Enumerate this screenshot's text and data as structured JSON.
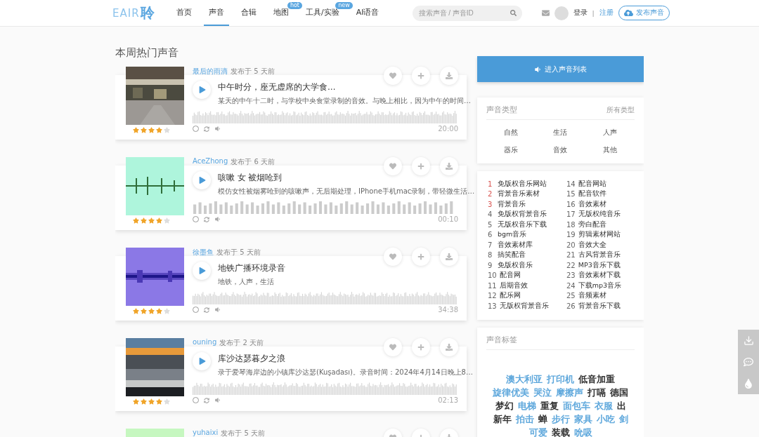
{
  "header": {
    "logo": {
      "latin": "EAIR",
      "hanzi": "聆"
    },
    "nav": [
      {
        "label": "首页",
        "selected": false
      },
      {
        "label": "声音",
        "selected": true
      },
      {
        "label": "合辑",
        "selected": false
      },
      {
        "label": "地图",
        "selected": false,
        "badge": "hot"
      },
      {
        "label": "工具/实验",
        "selected": false,
        "badge": "new"
      },
      {
        "label": "AI语音",
        "selected": false
      }
    ],
    "search": {
      "placeholder": "搜索声音 / 声音ID"
    },
    "login": "登录",
    "separator": "|",
    "register": "注册",
    "publish": "发布声音"
  },
  "hot": {
    "title": "本周热门声音",
    "items": [
      {
        "author": "最后的雨滴",
        "posted": "发布于 5 天前",
        "stars": 4,
        "title": "中午时分，座无虚席的大学食…",
        "description": "某天的中午十二时，与学校中央食堂录制的音效。与晚上相比，因为中午的时间…",
        "duration": "20:00"
      },
      {
        "author": "AceZhong",
        "posted": "发布于 6 天前",
        "stars": 4,
        "title": "咳嗽 女 被烟呛到",
        "description": "模仿女性被烟雾呛到的咳嗽声，无后期处理，IPhone手机mac录制，带轻微生活…",
        "duration": "00:10"
      },
      {
        "author": "徐墨鱼",
        "posted": "发布于 5 天前",
        "stars": 4,
        "title": "地铁广播环境录音",
        "description": "地铁，人声，生活",
        "duration": "34:38"
      },
      {
        "author": "ouning",
        "posted": "发布于 2 天前",
        "stars": 4,
        "title": "库沙达瑟暮夕之浪",
        "description": "录于爱琴海岸边的小镇库沙达瑟(Kuşadası)。录音时间：2024年4月14日晚上8…",
        "duration": "02:13"
      },
      {
        "author": "yuhaixi",
        "posted": "发布于 5 天前"
      }
    ]
  },
  "sidebar": {
    "list_button": "进入声音列表",
    "types": {
      "title": "声音类型",
      "all": "所有类型",
      "items": [
        "自然",
        "生活",
        "人声",
        "器乐",
        "音效",
        "其他"
      ]
    },
    "ranking": [
      {
        "rank": "1",
        "label": "免版权音乐网站",
        "highlighted": true
      },
      {
        "rank": "2",
        "label": "背景音乐素材",
        "highlighted": true
      },
      {
        "rank": "3",
        "label": "背景音乐",
        "highlighted": true
      },
      {
        "rank": "4",
        "label": "免版权背景音乐",
        "highlighted": false
      },
      {
        "rank": "5",
        "label": "无版权音乐下载",
        "highlighted": false
      },
      {
        "rank": "6",
        "label": "bgm音乐",
        "highlighted": false
      },
      {
        "rank": "7",
        "label": "音效素材库",
        "highlighted": false
      },
      {
        "rank": "8",
        "label": "搞笑配音",
        "highlighted": false
      },
      {
        "rank": "9",
        "label": "免版权音乐",
        "highlighted": false
      },
      {
        "rank": "10",
        "label": "配音网",
        "highlighted": false
      },
      {
        "rank": "11",
        "label": "后期音效",
        "highlighted": false
      },
      {
        "rank": "12",
        "label": "配乐网",
        "highlighted": false
      },
      {
        "rank": "13",
        "label": "无版权背景音乐",
        "highlighted": false
      },
      {
        "rank": "14",
        "label": "配音网站",
        "highlighted": false
      },
      {
        "rank": "15",
        "label": "配音软件",
        "highlighted": false
      },
      {
        "rank": "16",
        "label": "音效素材",
        "highlighted": false
      },
      {
        "rank": "17",
        "label": "无版权纯音乐",
        "highlighted": false
      },
      {
        "rank": "18",
        "label": "旁白配音",
        "highlighted": false
      },
      {
        "rank": "19",
        "label": "剪辑素材网站",
        "highlighted": false
      },
      {
        "rank": "20",
        "label": "音效大全",
        "highlighted": false
      },
      {
        "rank": "21",
        "label": "古风背景音乐",
        "highlighted": false
      },
      {
        "rank": "22",
        "label": "MP3音乐下载",
        "highlighted": false
      },
      {
        "rank": "23",
        "label": "音效素材下载",
        "highlighted": false
      },
      {
        "rank": "24",
        "label": "下载mp3音乐",
        "highlighted": false
      },
      {
        "rank": "25",
        "label": "音频素材",
        "highlighted": false
      },
      {
        "rank": "26",
        "label": "背景音乐下载",
        "highlighted": false
      }
    ],
    "tags": {
      "title": "声音标签",
      "items": [
        {
          "label": "澳大利亚",
          "color": "#5fa8dc"
        },
        {
          "label": "打印机",
          "color": "#5fa8dc"
        },
        {
          "label": "低音加重",
          "color": "#333333"
        },
        {
          "label": "旋律优美",
          "color": "#5fa8dc"
        },
        {
          "label": "哭泣",
          "color": "#5fa8dc"
        },
        {
          "label": "摩擦声",
          "color": "#5fa8dc"
        },
        {
          "label": "打嗝",
          "color": "#333333"
        },
        {
          "label": "德国",
          "color": "#333333"
        },
        {
          "label": "梦幻",
          "color": "#333333"
        },
        {
          "label": "电梯",
          "color": "#5fa8dc"
        },
        {
          "label": "重复",
          "color": "#333333"
        },
        {
          "label": "面包车",
          "color": "#5fa8dc"
        },
        {
          "label": "衣服",
          "color": "#5fa8dc"
        },
        {
          "label": "出",
          "color": "#333333"
        },
        {
          "label": "新年",
          "color": "#333333"
        },
        {
          "label": "拍击",
          "color": "#5fa8dc"
        },
        {
          "label": "蝉",
          "color": "#333333"
        },
        {
          "label": "步行",
          "color": "#5fa8dc"
        },
        {
          "label": "家具",
          "color": "#5fa8dc"
        },
        {
          "label": "小吃",
          "color": "#5fa8dc"
        },
        {
          "label": "剑",
          "color": "#5fa8dc"
        },
        {
          "label": "可爱",
          "color": "#5fa8dc"
        },
        {
          "label": "装载",
          "color": "#333333"
        },
        {
          "label": "吮吸",
          "color": "#5fa8dc"
        }
      ]
    }
  }
}
